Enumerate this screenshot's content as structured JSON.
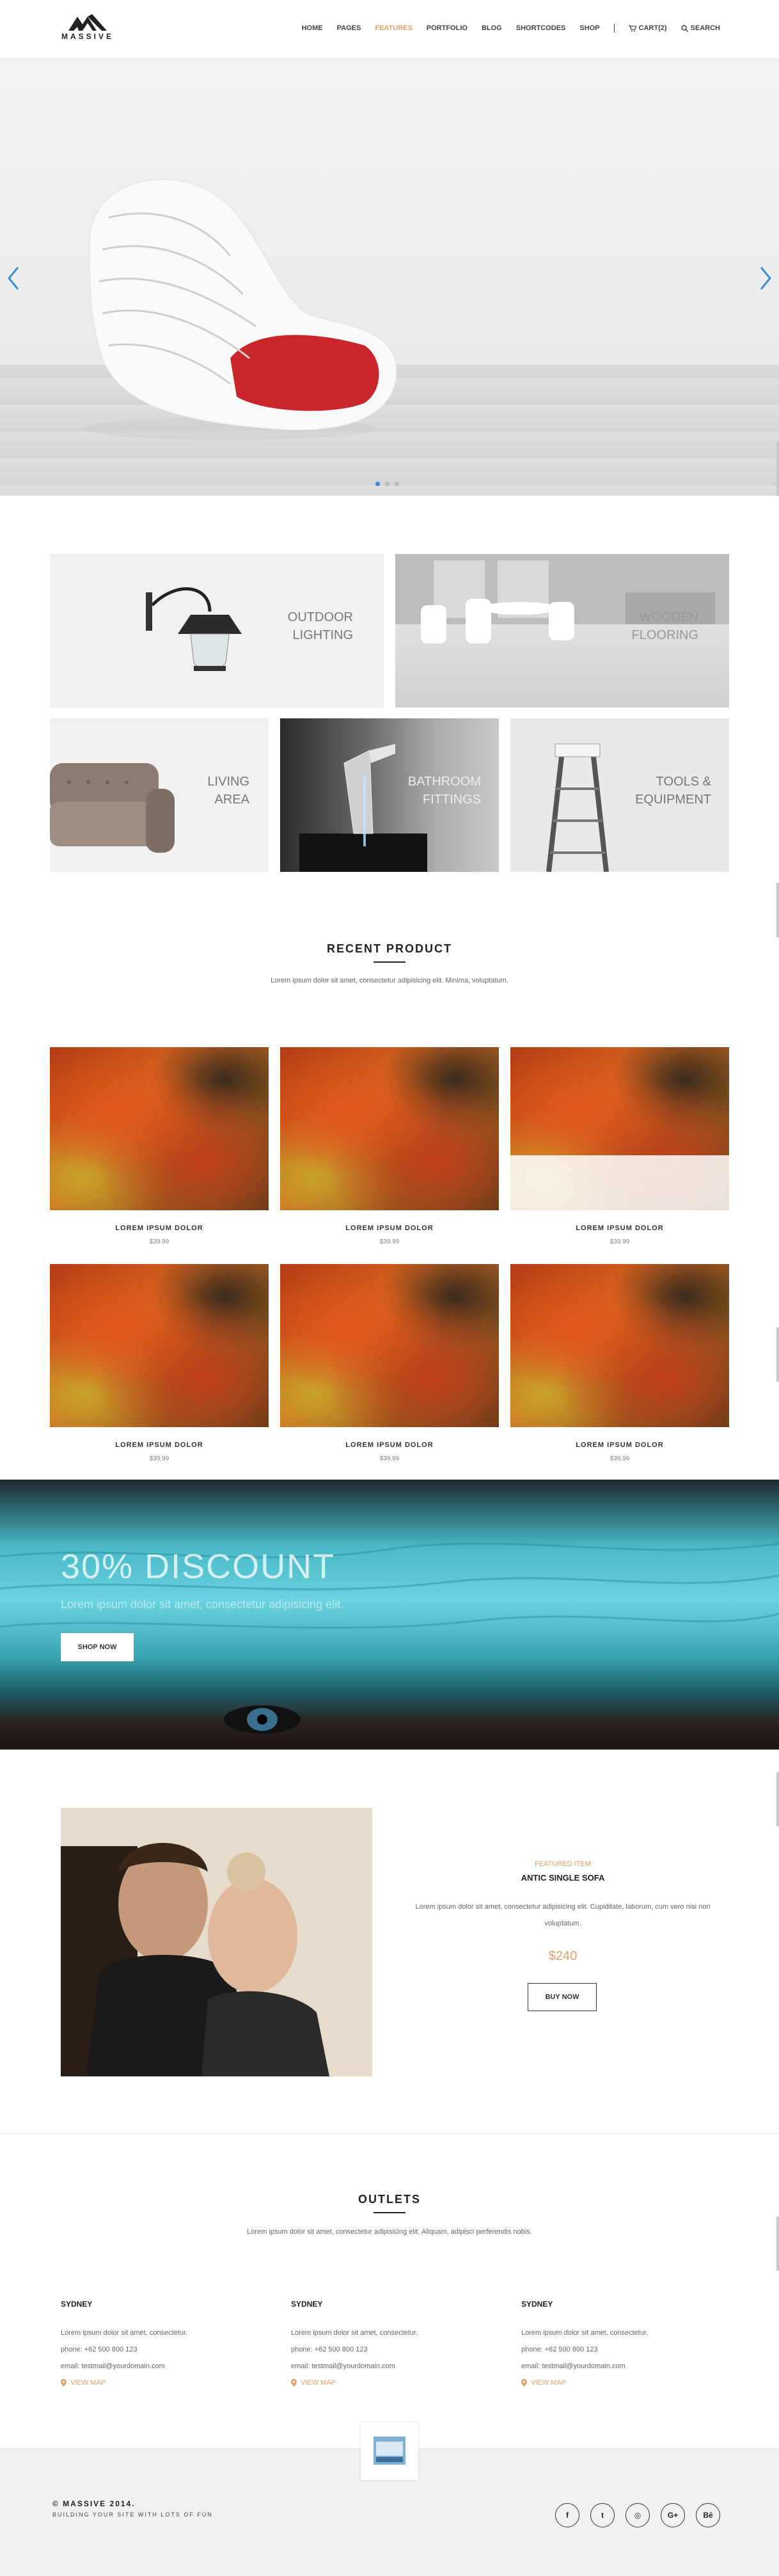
{
  "brand": {
    "name": "MASSIVE"
  },
  "nav": {
    "items": [
      {
        "label": "HOME",
        "active": false
      },
      {
        "label": "PAGES",
        "active": false
      },
      {
        "label": "FEATURES",
        "active": true
      },
      {
        "label": "PORTFOLIO",
        "active": false
      },
      {
        "label": "BLOG",
        "active": false
      },
      {
        "label": "SHORTCODES",
        "active": false
      },
      {
        "label": "SHOP",
        "active": false
      }
    ],
    "cart_label": "CART(2)",
    "search_label": "SEARCH"
  },
  "hero": {
    "slides": 3,
    "active_slide": 1
  },
  "categories": [
    {
      "title_line1": "OUTDOOR",
      "title_line2": "LIGHTING"
    },
    {
      "title_line1": "WOODEN",
      "title_line2": "FLOORING"
    },
    {
      "title_line1": "LIVING",
      "title_line2": "AREA"
    },
    {
      "title_line1": "BATHROOM",
      "title_line2": "FITTINGS"
    },
    {
      "title_line1": "TOOLS &",
      "title_line2": "EQUIPMENT"
    }
  ],
  "recent": {
    "title": "RECENT PRODUCT",
    "subtitle": "Lorem ipsum dolor sit amet, consectetur adipisicing elit. Minima, voluptatum.",
    "products": [
      {
        "name": "LOREM IPSUM DOLOR",
        "price": "$39.99"
      },
      {
        "name": "LOREM IPSUM DOLOR",
        "price": "$39.99"
      },
      {
        "name": "LOREM IPSUM DOLOR",
        "price": "$39.99"
      },
      {
        "name": "LOREM IPSUM DOLOR",
        "price": "$39.99"
      },
      {
        "name": "LOREM IPSUM DOLOR",
        "price": "$39.99"
      },
      {
        "name": "LOREM IPSUM DOLOR",
        "price": "$39.99"
      }
    ]
  },
  "discount": {
    "headline": "30% DISCOUNT",
    "text": "Lorem ipsum dolor sit amet, consectetur adipisicing elit.",
    "button": "SHOP NOW"
  },
  "featured": {
    "label": "FEATURED ITEM",
    "title": "ANTIC SINGLE SOFA",
    "text": "Lorem ipsum dolor sit amet, consectetur adipisicing elit. Cupiditate, laborum, cum vero nisi non voluptatum.",
    "price": "$240",
    "button": "BUY NOW"
  },
  "outlets": {
    "title": "OUTLETS",
    "subtitle": "Lorem ipsum dolor sit amet, consectetur adipisicing elit. Aliquam, adipisci perferendis nobis.",
    "items": [
      {
        "city": "SYDNEY",
        "desc": "Lorem ipsum dolor sit amet, consectetur.",
        "phone": "phone: +62 500 800 123",
        "email": "email: testmail@yourdomain.com",
        "map": "VIEW MAP"
      },
      {
        "city": "SYDNEY",
        "desc": "Lorem ipsum dolor sit amet, consectetur.",
        "phone": "phone: +62 500 800 123",
        "email": "email: testmail@yourdomain.com",
        "map": "VIEW MAP"
      },
      {
        "city": "SYDNEY",
        "desc": "Lorem ipsum dolor sit amet, consectetur.",
        "phone": "phone: +62 500 800 123",
        "email": "email: testmail@yourdomain.com",
        "map": "VIEW MAP"
      }
    ]
  },
  "footer": {
    "copyright": "© MASSIVE 2014.",
    "tagline": "BUILDING YOUR SITE WITH LOTS OF FUN",
    "socials": [
      "f",
      "t",
      "◎",
      "G+",
      "Bē"
    ]
  },
  "colors": {
    "accent": "#e3a06d",
    "slider_dot": "#3c8dd5"
  }
}
